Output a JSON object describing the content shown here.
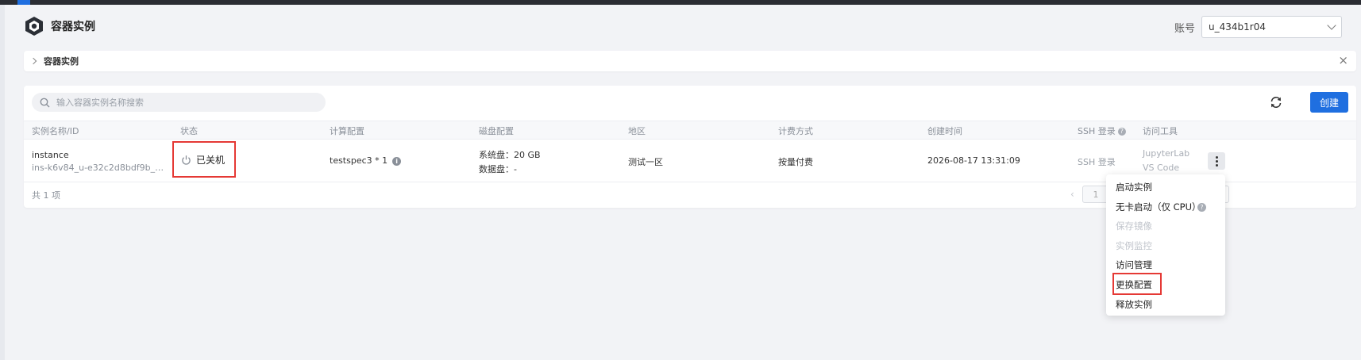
{
  "header": {
    "title": "容器实例",
    "account_label": "账号",
    "account_value": "u_434b1r04"
  },
  "breadcrumb": {
    "text": "容器实例",
    "close": "×"
  },
  "toolbar": {
    "search_placeholder": "输入容器实例名称搜索",
    "create_label": "创建"
  },
  "table": {
    "columns": {
      "name": "实例名称/ID",
      "status": "状态",
      "compute": "计算配置",
      "disk": "磁盘配置",
      "region": "地区",
      "billing": "计费方式",
      "created": "创建时间",
      "ssh": "SSH 登录",
      "tools": "访问工具"
    },
    "rows": [
      {
        "name": "instance",
        "id": "ins-k6v84_u-e32c2d8bdf9b_bzte...",
        "status": "已关机",
        "compute": "testspec3 * 1",
        "disk_system": "系统盘：20 GB",
        "disk_data": "数据盘：-",
        "region": "测试一区",
        "billing": "按量付费",
        "created": "2026-08-17 13:31:09",
        "ssh": "SSH 登录",
        "tool_jupyter": "JupyterLab",
        "tool_vscode": "VS Code"
      }
    ],
    "total": "共 1 项",
    "page": "1",
    "prev": "‹"
  },
  "menu": {
    "items": [
      {
        "label": "启动实例",
        "disabled": false
      },
      {
        "label": "无卡启动（仅 CPU）",
        "disabled": false
      },
      {
        "label": "保存镜像",
        "disabled": true
      },
      {
        "label": "实例监控",
        "disabled": true
      },
      {
        "label": "访问管理",
        "disabled": false
      },
      {
        "label": "更换配置",
        "disabled": false
      },
      {
        "label": "释放实例",
        "disabled": false
      }
    ]
  },
  "glyphs": {
    "help": "?",
    "info": "i"
  },
  "colors": {
    "primary": "#1f6fe0",
    "highlight": "#e53935",
    "topbar": "#2b2d33"
  }
}
